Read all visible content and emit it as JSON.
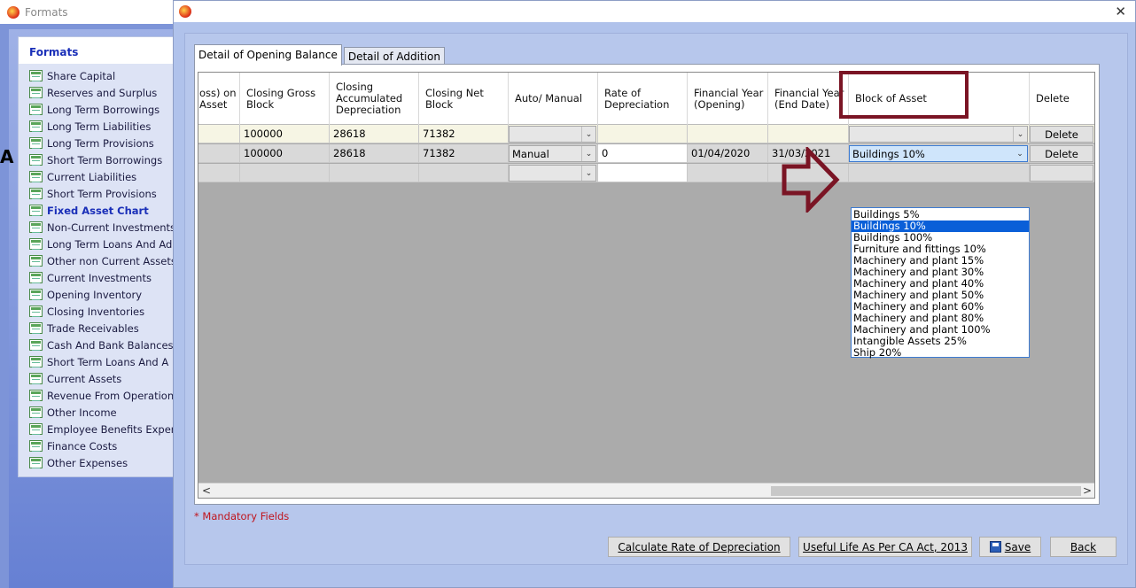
{
  "back_window": {
    "title": "Formats",
    "panel_title": "Formats",
    "items": [
      {
        "label": "Share Capital",
        "active": false
      },
      {
        "label": "Reserves and Surplus",
        "active": false
      },
      {
        "label": "Long Term Borrowings",
        "active": false
      },
      {
        "label": "Long Term Liabilities",
        "active": false
      },
      {
        "label": "Long Term Provisions",
        "active": false
      },
      {
        "label": "Short Term Borrowings",
        "active": false
      },
      {
        "label": "Current Liabilities",
        "active": false
      },
      {
        "label": "Short Term Provisions",
        "active": false
      },
      {
        "label": "Fixed Asset Chart",
        "active": true
      },
      {
        "label": "Non-Current Investments",
        "active": false
      },
      {
        "label": "Long Term Loans And Ad",
        "active": false
      },
      {
        "label": "Other non Current Assets",
        "active": false
      },
      {
        "label": "Current Investments",
        "active": false
      },
      {
        "label": "Opening Inventory",
        "active": false
      },
      {
        "label": "Closing Inventories",
        "active": false
      },
      {
        "label": "Trade Receivables",
        "active": false
      },
      {
        "label": "Cash And Bank Balances",
        "active": false
      },
      {
        "label": "Short Term Loans And A",
        "active": false
      },
      {
        "label": "Current Assets",
        "active": false
      },
      {
        "label": "Revenue From Operation",
        "active": false
      },
      {
        "label": "Other Income",
        "active": false
      },
      {
        "label": "Employee Benefits Expen",
        "active": false
      },
      {
        "label": "Finance Costs",
        "active": false
      },
      {
        "label": "Other Expenses",
        "active": false
      }
    ]
  },
  "dialog": {
    "close_glyph": "✕",
    "tabs": [
      {
        "label": "Detail of Opening Balance",
        "active": true
      },
      {
        "label": "Detail of Addition",
        "active": false
      }
    ],
    "columns": [
      "oss) on\nAsset",
      "Closing Gross\nBlock",
      "Closing\nAccumulated\nDepreciation",
      "Closing Net\nBlock",
      "Auto/ Manual",
      "Rate of\nDepreciation",
      "Financial Year\n(Opening)",
      "Financial Year\n(End Date)",
      "Block of Asset",
      "Delete"
    ],
    "rows": [
      {
        "closing_gross": "100000",
        "closing_acc_dep": "28618",
        "closing_net": "71382",
        "auto_manual": "",
        "rate": "",
        "fy_open": "",
        "fy_end": "",
        "block": "",
        "delete": "Delete"
      },
      {
        "closing_gross": "100000",
        "closing_acc_dep": "28618",
        "closing_net": "71382",
        "auto_manual": "Manual",
        "rate": "0",
        "fy_open": "01/04/2020",
        "fy_end": "31/03/2021",
        "block": "Buildings 10%",
        "delete": "Delete"
      },
      {
        "closing_gross": "",
        "closing_acc_dep": "",
        "closing_net": "",
        "auto_manual": "",
        "rate": "",
        "fy_open": "",
        "fy_end": "",
        "block": "",
        "delete": ""
      }
    ],
    "dropdown_options": [
      "Buildings 5%",
      "Buildings 10%",
      "Buildings 100%",
      "Furniture and fittings 10%",
      "Machinery and plant 15%",
      "Machinery and plant 30%",
      "Machinery and plant 40%",
      "Machinery and plant 50%",
      "Machinery and plant 60%",
      "Machinery and plant 80%",
      "Machinery and plant 100%",
      "Intangible Assets 25%",
      "Ship 20%"
    ],
    "dropdown_selected": "Buildings 10%",
    "mandatory_note": "* Mandatory Fields",
    "buttons": {
      "calc_rate": "Calculate Rate of Depreciation",
      "useful_life": "Useful Life As Per CA Act, 2013",
      "save": "Save",
      "back": "Back"
    },
    "scroll_left": "<",
    "scroll_right": ">"
  },
  "colors": {
    "annotation": "#7a1424",
    "selection": "#0a5fd8",
    "mandatory": "#c0141c",
    "link_active": "#1a2fb8"
  }
}
